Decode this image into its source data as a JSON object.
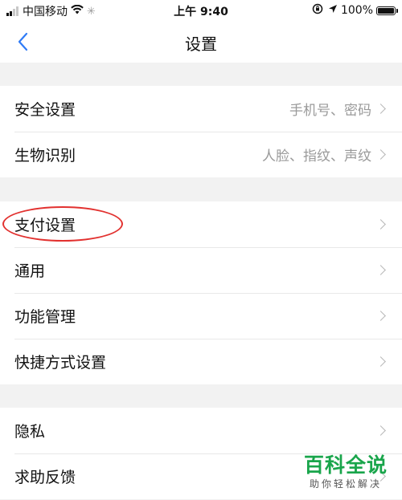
{
  "status_bar": {
    "carrier": "中国移动",
    "time": "上午 9:40",
    "battery": "100%",
    "icons": [
      "signal-icon",
      "wifi-icon",
      "loading-icon",
      "orientation-lock-icon",
      "location-icon",
      "battery-icon"
    ]
  },
  "nav": {
    "title": "设置",
    "back_icon": "chevron-left-icon"
  },
  "groups": [
    {
      "items": [
        {
          "label": "安全设置",
          "detail": "手机号、密码"
        },
        {
          "label": "生物识别",
          "detail": "人脸、指纹、声纹"
        }
      ]
    },
    {
      "items": [
        {
          "label": "支付设置",
          "highlighted": true
        },
        {
          "label": "通用"
        },
        {
          "label": "功能管理"
        },
        {
          "label": "快捷方式设置"
        }
      ]
    },
    {
      "items": [
        {
          "label": "隐私"
        },
        {
          "label": "求助反馈"
        }
      ]
    }
  ],
  "watermark": {
    "title": "百科全说",
    "subtitle": "助你轻松解决"
  },
  "colors": {
    "accent": "#2f7bf6",
    "highlight": "#e2312f",
    "watermark_green": "#19a54b",
    "background": "#f2f2f2"
  }
}
